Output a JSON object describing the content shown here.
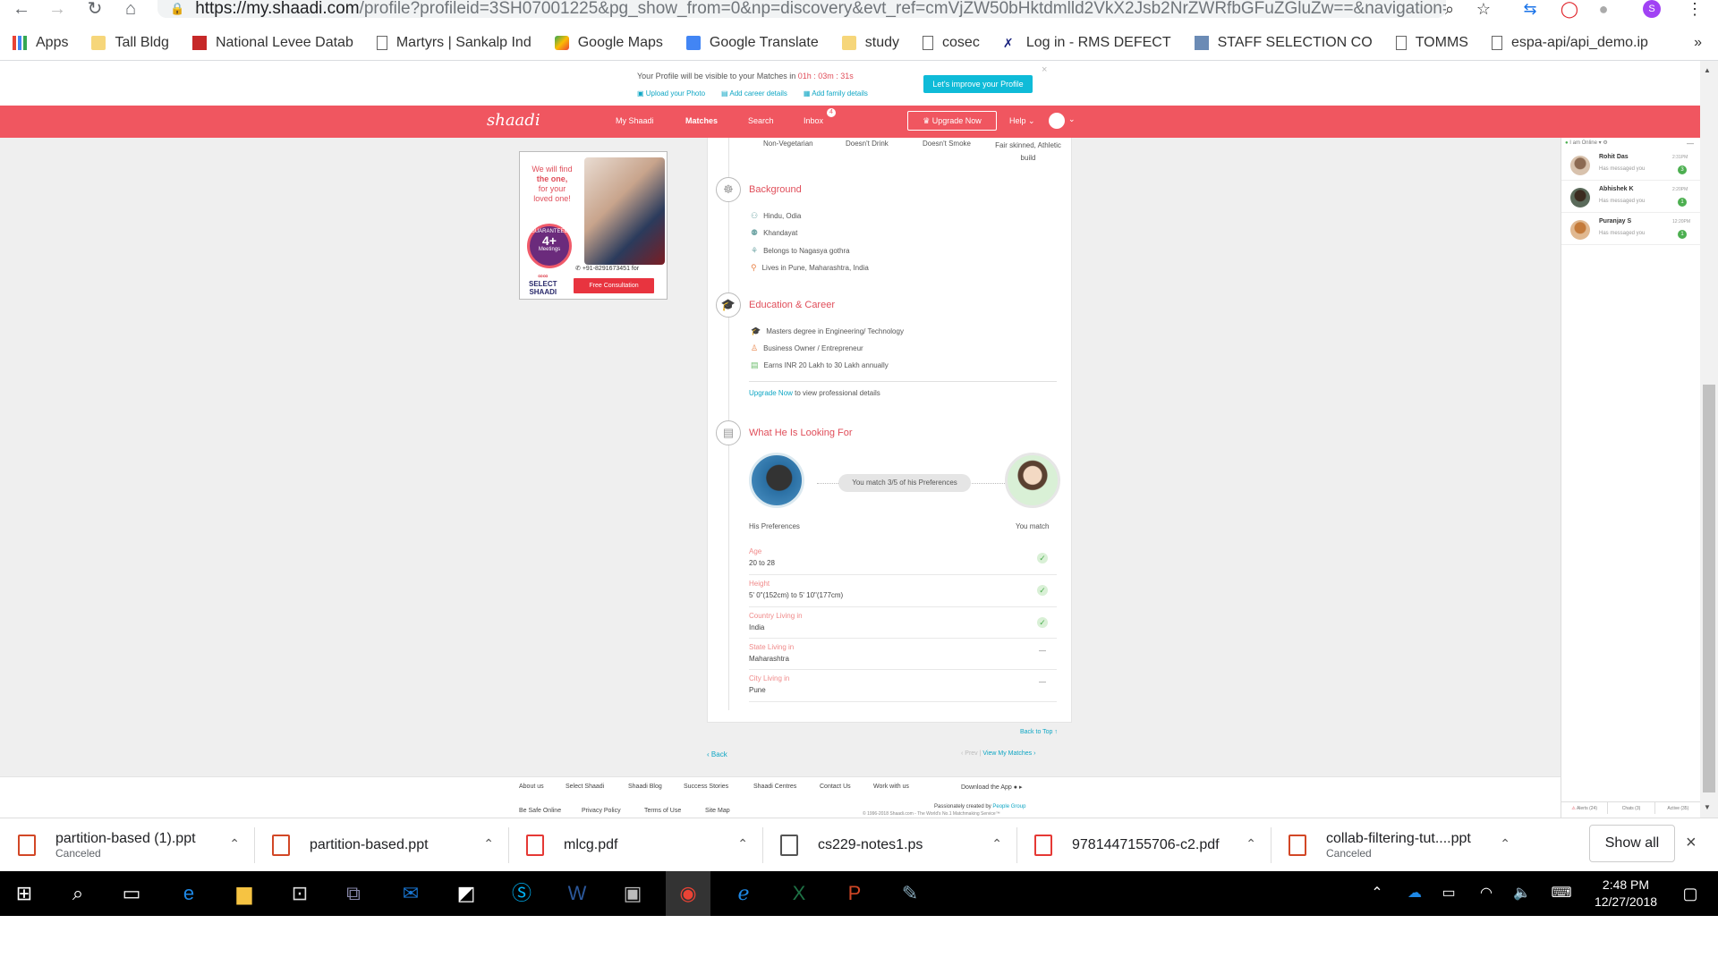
{
  "browser": {
    "url_host": "https://my.shaadi.com",
    "url_path": "/profile?profileid=3SH07001225&pg_show_from=0&np=discovery&evt_ref=cmVjZW50bHktdmlld2VkX2Jsb2NrZWRfbGFuZGluZw==&navigation=0&profi...",
    "profile_initial": "S",
    "bookmarks": [
      "Apps",
      "Tall Bldg",
      "National Levee Datab",
      "Martyrs | Sankalp Ind",
      "Google Maps",
      "Google Translate",
      "study",
      "cosec",
      "Log in - RMS DEFECT",
      "STAFF SELECTION CO",
      "TOMMS",
      "espa-api/api_demo.ip"
    ],
    "bookmarks_more": "»"
  },
  "banner": {
    "text_prefix": "Your Profile will be visible to your Matches in",
    "countdown": "01h : 03m : 31s",
    "improve_button": "Let's improve your Profile",
    "links": [
      "Upload your Photo",
      "Add career details",
      "Add family details"
    ]
  },
  "nav": {
    "logo": "shaadi",
    "items": [
      "My Shaadi",
      "Matches",
      "Search",
      "Inbox"
    ],
    "inbox_badge": "4",
    "upgrade": "Upgrade Now",
    "help": "Help"
  },
  "ad": {
    "line1": "We will find",
    "line2": "the one,",
    "line3": "for your",
    "line4": "loved one!",
    "badge_num": "4+",
    "badge_label": "Meetings",
    "badge_arc": "GUARANTEED",
    "phone": "+91-8291673451",
    "phone_suffix": "for",
    "brand1": "SELECT",
    "brand2": "SHAADI",
    "cta": "Free Consultation"
  },
  "profile": {
    "top_traits": [
      "Non-Vegetarian",
      "Doesn't Drink",
      "Doesn't Smoke",
      "Fair skinned, Athletic build"
    ],
    "background": {
      "title": "Background",
      "items": [
        "Hindu, Odia",
        "Khandayat",
        "Belongs to Nagasya gothra",
        "Lives in Pune, Maharashtra, India"
      ]
    },
    "education": {
      "title": "Education & Career",
      "items": [
        "Masters degree in Engineering/ Technology",
        "Business Owner / Entrepreneur",
        "Earns INR 20 Lakh to 30 Lakh annually"
      ],
      "upgrade_link": "Upgrade Now",
      "upgrade_text": "to view professional details"
    },
    "looking_for": {
      "title": "What He Is Looking For",
      "match_pill": "You match 3/5 of his Preferences",
      "his_label": "His Preferences",
      "you_label": "You match",
      "prefs": [
        {
          "label": "Age",
          "value": "20 to 28",
          "match": "✓"
        },
        {
          "label": "Height",
          "value": "5' 0\"(152cm) to 5' 10\"(177cm)",
          "match": "✓"
        },
        {
          "label": "Country Living in",
          "value": "India",
          "match": "✓"
        },
        {
          "label": "State Living in",
          "value": "Maharashtra",
          "match": "—"
        },
        {
          "label": "City Living in",
          "value": "Pune",
          "match": "—"
        }
      ]
    },
    "back_to_top": "Back to Top",
    "back": "Back",
    "prev": "Prev",
    "view_matches": "View My Matches"
  },
  "chat": {
    "status": "I am Online",
    "contacts": [
      {
        "name": "Rohit Das",
        "time": "2:31PM",
        "msg": "Has messaged you",
        "count": "3"
      },
      {
        "name": "Abhishek K",
        "time": "2:20PM",
        "msg": "Has messaged you",
        "count": "1"
      },
      {
        "name": "Puranjay S",
        "time": "12:20PM",
        "msg": "Has messaged you",
        "count": "1"
      }
    ],
    "tabs": [
      "Alerts (24)",
      "Chats (3)",
      "Active (35)"
    ]
  },
  "footer": {
    "links1": [
      "About us",
      "Select Shaadi",
      "Shaadi Blog",
      "Success Stories",
      "Shaadi Centres",
      "Contact Us",
      "Work with us"
    ],
    "download_app": "Download the App",
    "links2": [
      "Be Safe Online",
      "Privacy Policy",
      "Terms of Use",
      "Site Map"
    ],
    "created_by": "Passionately created by",
    "people_group": "People Group",
    "copyright": "© 1996-2018 Shaadi.com - The World's No.1 Matchmaking Service™"
  },
  "downloads": [
    {
      "name": "partition-based (1).ppt",
      "sub": "Canceled",
      "type": "ppt"
    },
    {
      "name": "partition-based.ppt",
      "sub": "",
      "type": "ppt"
    },
    {
      "name": "mlcg.pdf",
      "sub": "",
      "type": "pdf"
    },
    {
      "name": "cs229-notes1.ps",
      "sub": "",
      "type": "ps"
    },
    {
      "name": "9781447155706-c2.pdf",
      "sub": "",
      "type": "pdf"
    },
    {
      "name": "collab-filtering-tut....ppt",
      "sub": "Canceled",
      "type": "ppt"
    }
  ],
  "show_all": "Show all",
  "taskbar": {
    "time": "2:48 PM",
    "date": "12/27/2018"
  }
}
